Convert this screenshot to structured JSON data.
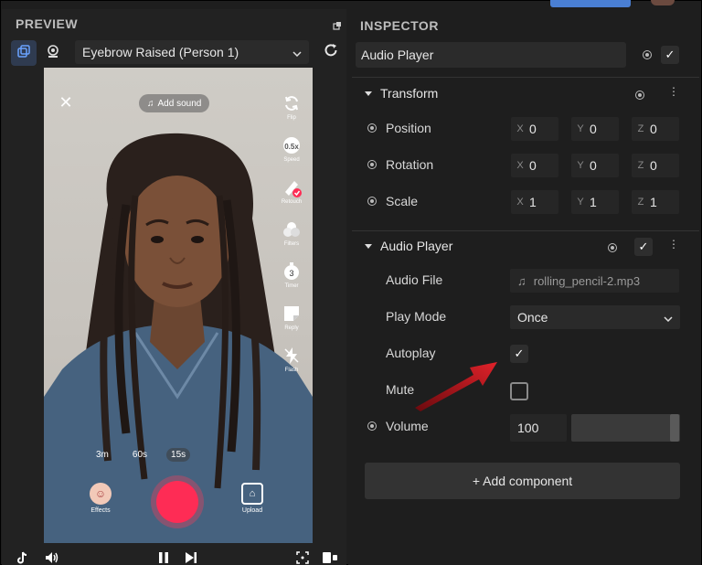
{
  "preview": {
    "title": "PREVIEW",
    "preset": "Eyebrow Raised (Person 1)",
    "add_sound": "Add sound",
    "tools": [
      {
        "name": "flip",
        "label": "Flip"
      },
      {
        "name": "speed",
        "label": "Speed"
      },
      {
        "name": "retouch",
        "label": "Retouch"
      },
      {
        "name": "filters",
        "label": "Filters"
      },
      {
        "name": "timer",
        "label": "Timer"
      },
      {
        "name": "reply",
        "label": "Reply"
      },
      {
        "name": "flash",
        "label": "Flash"
      }
    ],
    "speed_badge": "0.5x",
    "durations": [
      "3m",
      "60s",
      "15s"
    ],
    "selected_duration": "15s",
    "effects_label": "Effects",
    "upload_label": "Upload"
  },
  "inspector": {
    "title": "INSPECTOR",
    "object_name": "Audio Player",
    "transform": {
      "title": "Transform",
      "rows": [
        {
          "label": "Position",
          "x": "0",
          "y": "0",
          "z": "0"
        },
        {
          "label": "Rotation",
          "x": "0",
          "y": "0",
          "z": "0"
        },
        {
          "label": "Scale",
          "x": "1",
          "y": "1",
          "z": "1"
        }
      ],
      "axes": [
        "X",
        "Y",
        "Z"
      ]
    },
    "audio_player": {
      "title": "Audio Player",
      "audio_file_label": "Audio File",
      "audio_file_value": "rolling_pencil-2.mp3",
      "play_mode_label": "Play Mode",
      "play_mode_value": "Once",
      "autoplay_label": "Autoplay",
      "autoplay_checked": true,
      "mute_label": "Mute",
      "mute_checked": false,
      "volume_label": "Volume",
      "volume_value": "100"
    },
    "add_component": "+ Add component"
  },
  "colors": {
    "accent_blue": "#4a7fd3",
    "record_red": "#fe2c55",
    "arrow_red": "#d4161e"
  }
}
